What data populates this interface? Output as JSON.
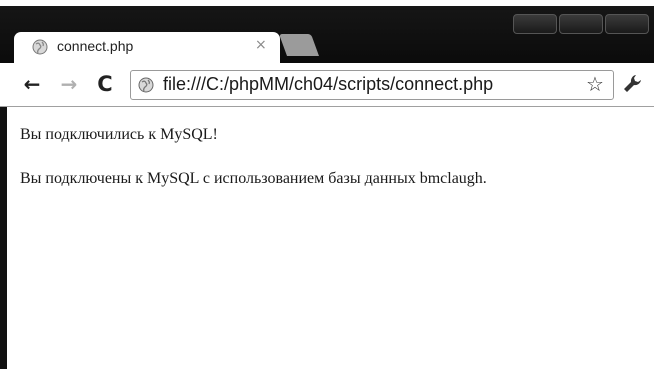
{
  "browser": {
    "tab": {
      "title": "connect.php",
      "close_glyph": "×",
      "favicon": "globe-icon"
    },
    "toolbar": {
      "back_glyph": "←",
      "forward_glyph": "→",
      "reload_glyph": "C",
      "url": "file:///C:/phpMM/ch04/scripts/connect.php",
      "star_glyph": "☆",
      "wrench": "wrench-icon"
    },
    "window_controls": [
      "minimize",
      "maximize",
      "close"
    ]
  },
  "page": {
    "line1": "Вы подключились к MySQL!",
    "line2": "Вы подключены к MySQL с использованием базы данных bmclaugh."
  },
  "colors": {
    "titlebar": "#111111",
    "content_background": "#ffffff",
    "text": "#1a1a1a"
  }
}
